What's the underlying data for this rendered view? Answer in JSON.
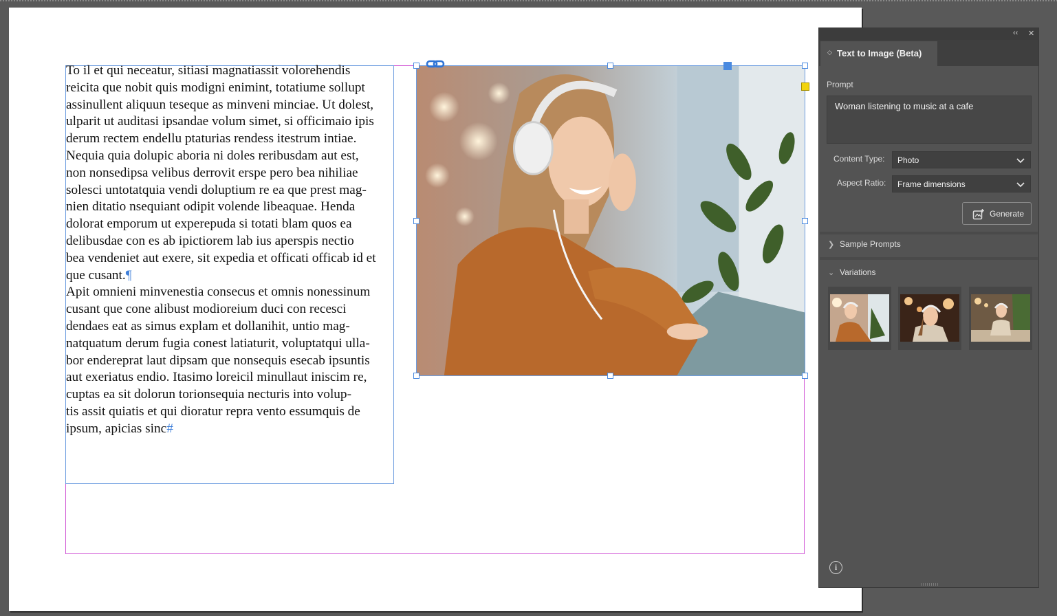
{
  "document": {
    "story_lines": [
      "To il et qui neceatur, sitiasi magnatiassit volorehendis",
      "reicita que nobit quis modigni enimint, totatiume sollupt",
      "assinullent aliquun teseque as minveni minciae. Ut dolest,",
      "ulparit ut auditasi ipsandae volum simet, si officimaio ipis",
      "derum rectem endellu ptaturias rendess itestrum intiae.",
      "Nequia quia dolupic aboria ni doles reribusdam aut est,",
      "non nonsedipsa velibus derrovit erspe pero bea nihiliae",
      "solesci untotatquia vendi doluptium re ea que prest mag-",
      "nien ditatio nsequiant odipit volende libeaquae. Henda",
      "dolorat emporum ut experepuda si totati blam quos ea",
      "delibusdae con es ab ipictiorem lab ius aperspis nectio",
      "bea vendeniet aut exere, sit expedia et officati officab id et",
      "que cusant.",
      "Apit omnieni minvenestia consecus et omnis nonessinum",
      "cusant que cone alibust modioreium duci con recesci",
      "dendaes eat as simus explam et dollanihit, untio mag-",
      "natquatum derum fugia conest latiaturit, voluptatqui ulla-",
      "bor endereprat laut dipsam que nonsequis esecab ipsuntis",
      "aut exeriatus endio. Itasimo loreicil minullaut iniscim re,",
      "cuptas ea sit dolorun torionsequia necturis into volup-",
      "tis assit quiatis et qui dioratur repra vento essumquis de",
      "ipsum, apicias sinc"
    ],
    "paragraph_mark": "¶",
    "end_of_story_mark": "#"
  },
  "panel": {
    "title": "Text to Image (Beta)",
    "collapse_glyph": "‹‹",
    "close_glyph": "✕",
    "prompt_label": "Prompt",
    "prompt_value": "Woman listening to music at a cafe",
    "content_type_label": "Content Type:",
    "content_type_value": "Photo",
    "aspect_ratio_label": "Aspect Ratio:",
    "aspect_ratio_value": "Frame dimensions",
    "generate_label": "Generate",
    "sample_prompts_label": "Sample Prompts",
    "variations_label": "Variations",
    "info_glyph": "i"
  },
  "colors": {
    "frame_selection": "#4a8ae0",
    "margin_guide": "#d25ad6",
    "panel_bg": "#535353"
  }
}
